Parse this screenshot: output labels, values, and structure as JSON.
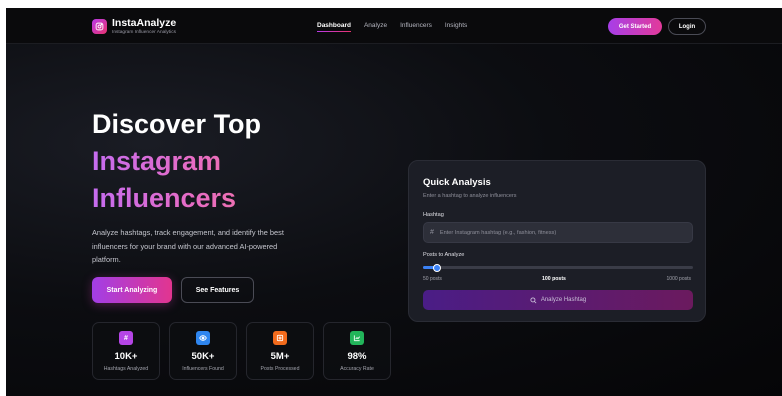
{
  "brand": {
    "name": "InstaAnalyze",
    "tagline": "Instagram Influencer Analytics",
    "icon": "instagram-icon",
    "accent": "#c13ae6"
  },
  "nav": {
    "links": [
      {
        "label": "Dashboard",
        "active": true
      },
      {
        "label": "Analyze",
        "active": false
      },
      {
        "label": "Influencers",
        "active": false
      },
      {
        "label": "Insights",
        "active": false
      }
    ],
    "get_started": "Get Started",
    "login": "Login"
  },
  "hero": {
    "title_line1": "Discover Top",
    "title_line2": "Instagram",
    "title_line3": "Influencers",
    "description": "Analyze hashtags, track engagement, and identify the best influencers for your brand with our advanced AI-powered platform.",
    "primary_cta": "Start Analyzing",
    "secondary_cta": "See Features"
  },
  "stats": [
    {
      "icon": "hash-icon",
      "glyph": "#",
      "color": "#b545e6",
      "value": "10K+",
      "label": "Hashtags Analyzed"
    },
    {
      "icon": "eye-icon",
      "glyph": "",
      "color": "#2f86f0",
      "value": "50K+",
      "label": "Influencers Found"
    },
    {
      "icon": "image-icon",
      "glyph": "",
      "color": "#f36b1c",
      "value": "5M+",
      "label": "Posts Processed"
    },
    {
      "icon": "chart-icon",
      "glyph": "",
      "color": "#22b45a",
      "value": "98%",
      "label": "Accuracy Rate"
    }
  ],
  "quick_analysis": {
    "title": "Quick Analysis",
    "subtitle": "Enter a hashtag to analyze influencers",
    "hashtag_label": "Hashtag",
    "hashtag_placeholder": "Enter Instagram hashtag (e.g., fashion, fitness)",
    "posts_label": "Posts to Analyze",
    "posts_min": "50 posts",
    "posts_value": "100 posts",
    "posts_max": "1000 posts",
    "slider": {
      "min": 50,
      "max": 1000,
      "value": 100
    },
    "submit": "Analyze Hashtag"
  }
}
